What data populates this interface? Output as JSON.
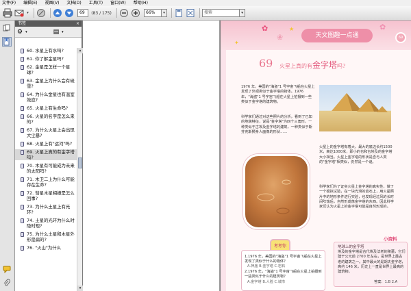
{
  "menu": [
    "文件(F)",
    "编辑(E)",
    "视图(V)",
    "文档(D)",
    "工具(T)",
    "窗口(W)",
    "帮助(H)"
  ],
  "toolbar": {
    "page_current": "69",
    "page_total": "(83 / 175)",
    "zoom": "66%",
    "search_placeholder": "搜索"
  },
  "bookmarks": {
    "header": "书签",
    "close": "×",
    "items": [
      {
        "text": "60. 水星上有水吗?",
        "selected": false
      },
      {
        "text": "61. 你了解金星吗?",
        "selected": false
      },
      {
        "text": "62. 金星是怎样一个星球?",
        "selected": false
      },
      {
        "text": "63. 金星上为什么会有硫雪?",
        "selected": false
      },
      {
        "text": "64. 为什么金星也有温室效应?",
        "selected": false
      },
      {
        "text": "65. 火星上有生命吗?",
        "selected": false
      },
      {
        "text": "66. 火星的名字是怎么来的?",
        "selected": false
      },
      {
        "text": "67. 为什么火星上会出现大尘暴?",
        "selected": false
      },
      {
        "text": "68. 火星上有\"运河\"吗?",
        "selected": false
      },
      {
        "text": "69. 火星上真的有金字塔吗?",
        "selected": true
      },
      {
        "text": "70. 木星有可能成为未来的太阳吗?",
        "selected": false
      },
      {
        "text": "71. 木卫二上为什么可能存在生命?",
        "selected": false
      },
      {
        "text": "72. 彗星木星相撞是怎么回事?",
        "selected": false
      },
      {
        "text": "73. 为什么土星上有光环?",
        "selected": false
      },
      {
        "text": "74. 土星的光环为什么时隐时现?",
        "selected": false
      },
      {
        "text": "75. 为什么土星和木星外形是扁的?",
        "selected": false
      },
      {
        "text": "76. \"火山\"为什么",
        "selected": false
      }
    ]
  },
  "page": {
    "header_title": "天文图趣一点通",
    "page_number": "69",
    "question_number": "69",
    "question_prefix": "火星上真的有",
    "question_highlight": "金字塔",
    "question_suffix": "吗?",
    "para1": "1976 年，美国的\"海盗\"1 号宇宙飞船在火星上发现了外观类似于金字塔的物体。1976 年，\"海盗\"1 号宇宙飞船在火星上拍摄到一些类似于金字塔的建筑物。",
    "para2": "科学家们通过对这些照片的分析，看到了已知的地貌特征，说是\"金字塔\"为四个三角形，一种类似于古埃及金字塔的建筑，一种类似于斯芬克斯狮身人面像的形状……",
    "para3": "火星上的金字塔有着大，最大的底边长约1500米，高达1000米，即小的也和古埃及的金字塔大小相当。火星上金字塔的形状是否与人类的\"金字塔\"相类似，仍然是一个谜。",
    "para4": "科学家们为了证实火星上金字塔的真实性，做了一个模拟试验，在一块光滑的岩石上，用火星照片中的地形条件进行实验，也发现经过风的长时间吹蚀后，自然形成像金字塔的东西。因此科学家们认为火星上的金字塔可能是自然形成的。",
    "badge": "考考你",
    "quiz_q1": "1.1976 年，美国的\"海盗\"1 号宇宙飞船在火星上发现了类似于什么的物体？",
    "quiz_opts1": "A.神庙  B.金字塔  C.岩石",
    "quiz_q2": "2.1976 年，\"海盗\"1 号宇宙飞船在火星上拍摄到一些类似于什么的建筑物？",
    "quiz_opts2": "A.金字塔  B.人脸  C.城市",
    "info_title": "地球上的金字塔",
    "xiaoziliao": "小资料",
    "info_text": "埃及的金字塔是古代埃及法老的陵墓，它们建于公元前 2700 年左右，是世界上最古老的建筑之一。其中最大的是胡夫金字塔，高约 146 米，历史上一直是世界上最高的建筑物。",
    "answer": "答案：1.B 2.A"
  }
}
